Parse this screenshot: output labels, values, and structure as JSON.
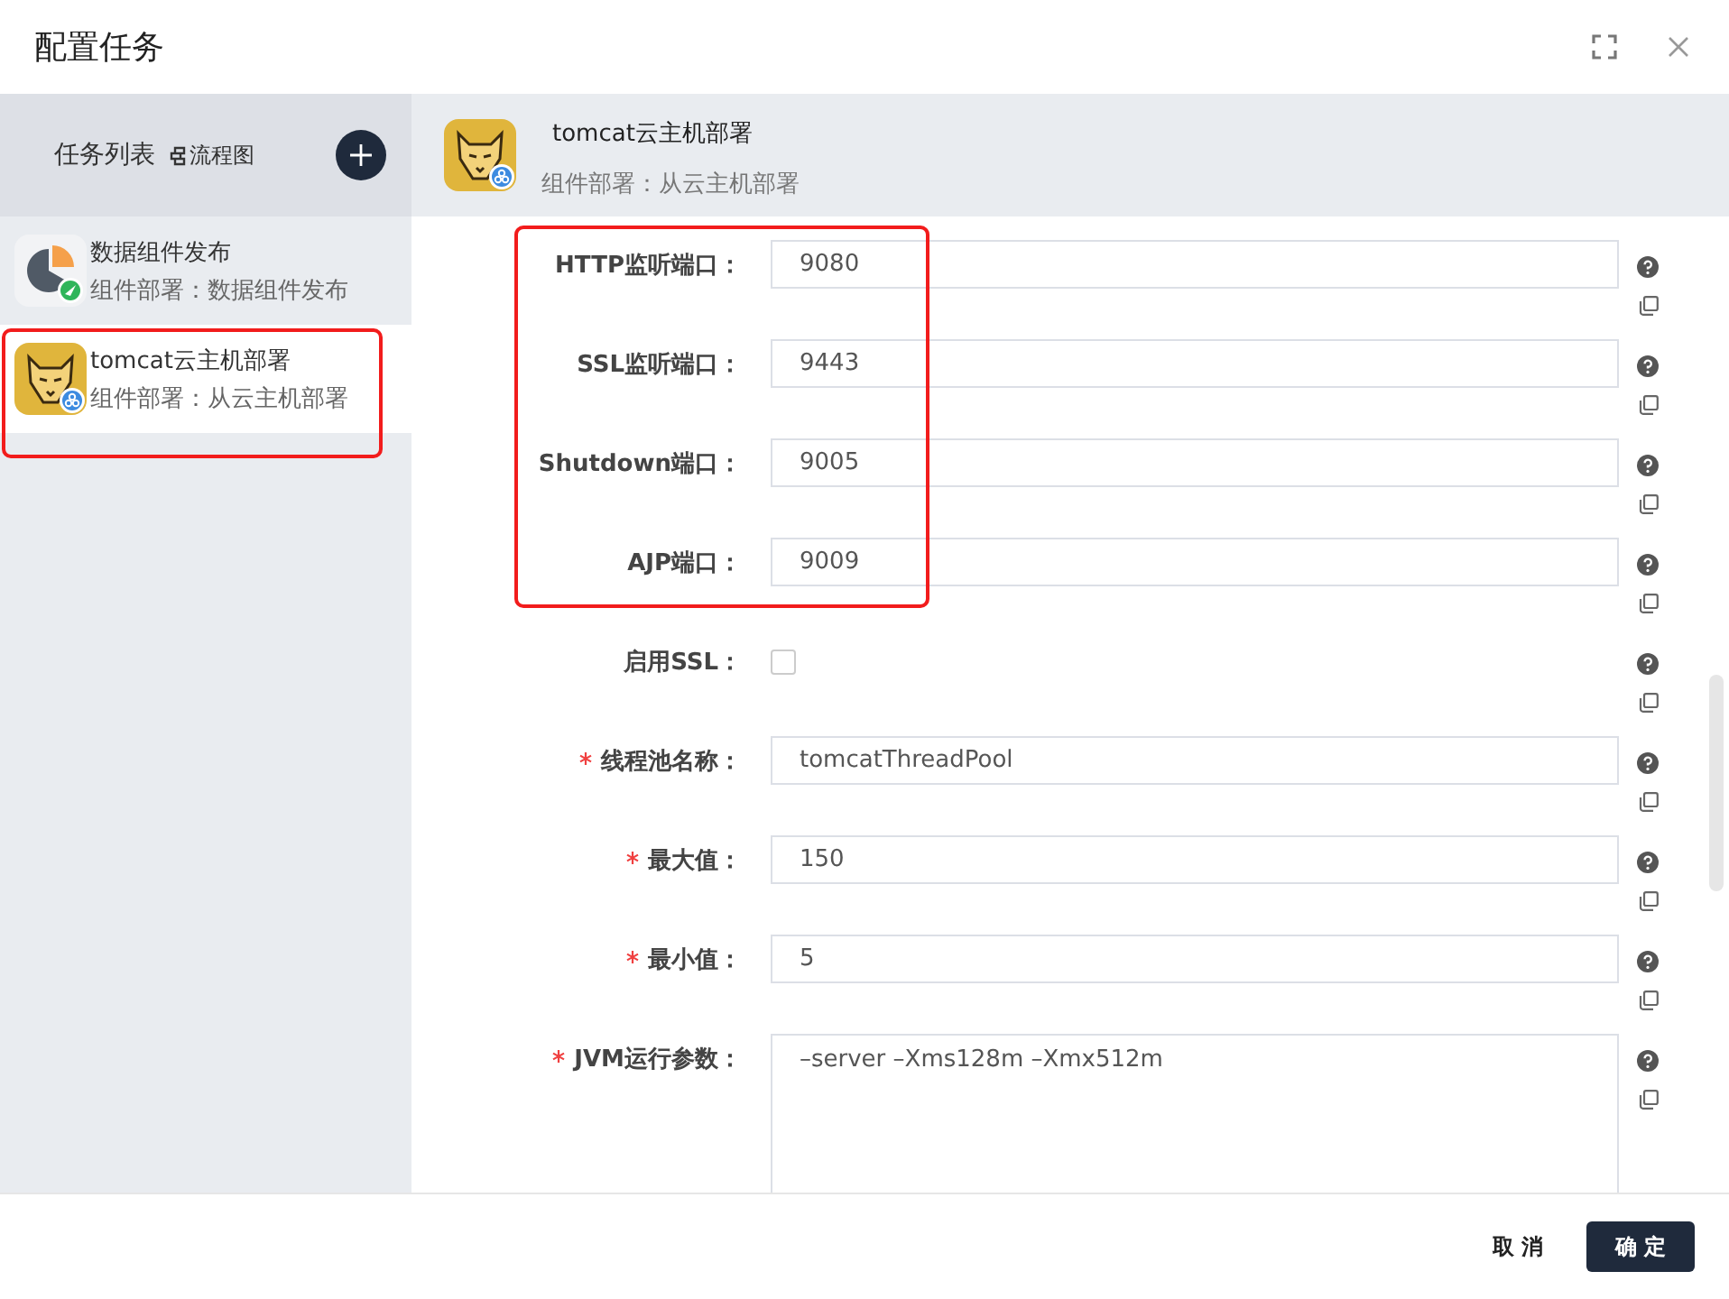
{
  "dialog": {
    "title": "配置任务"
  },
  "sidebar": {
    "title": "任务列表",
    "flow_link": "流程图",
    "items": [
      {
        "kind": "pie",
        "name": "数据组件发布",
        "subtitle": "组件部署：数据组件发布",
        "selected": false,
        "highlighted": false
      },
      {
        "kind": "cat",
        "name": "tomcat云主机部署",
        "subtitle": "组件部署：从云主机部署",
        "selected": true,
        "highlighted": true
      }
    ]
  },
  "task_header": {
    "kind": "cat",
    "name": "tomcat云主机部署",
    "subtitle": "组件部署：从云主机部署"
  },
  "field_groups": [
    {
      "highlighted": true,
      "fields": [
        {
          "kind": "text",
          "label": "HTTP监听端口：",
          "required": false,
          "value": "9080"
        },
        {
          "kind": "text",
          "label": "SSL监听端口：",
          "required": false,
          "value": "9443"
        },
        {
          "kind": "text",
          "label": "Shutdown端口：",
          "required": false,
          "value": "9005"
        },
        {
          "kind": "text",
          "label": "AJP端口：",
          "required": false,
          "value": "9009"
        }
      ]
    },
    {
      "highlighted": false,
      "fields": [
        {
          "kind": "checkbox",
          "label": "启用SSL：",
          "required": false,
          "checked": false
        },
        {
          "kind": "text",
          "label": "线程池名称：",
          "required": true,
          "value": "tomcatThreadPool"
        },
        {
          "kind": "text",
          "label": "最大值：",
          "required": true,
          "value": "150"
        },
        {
          "kind": "text",
          "label": "最小值：",
          "required": true,
          "value": "5"
        },
        {
          "kind": "textarea",
          "label": "JVM运行参数：",
          "required": true,
          "value": "–server –Xms128m –Xmx512m"
        }
      ]
    }
  ],
  "footer": {
    "cancel": "取 消",
    "confirm": "确 定"
  }
}
